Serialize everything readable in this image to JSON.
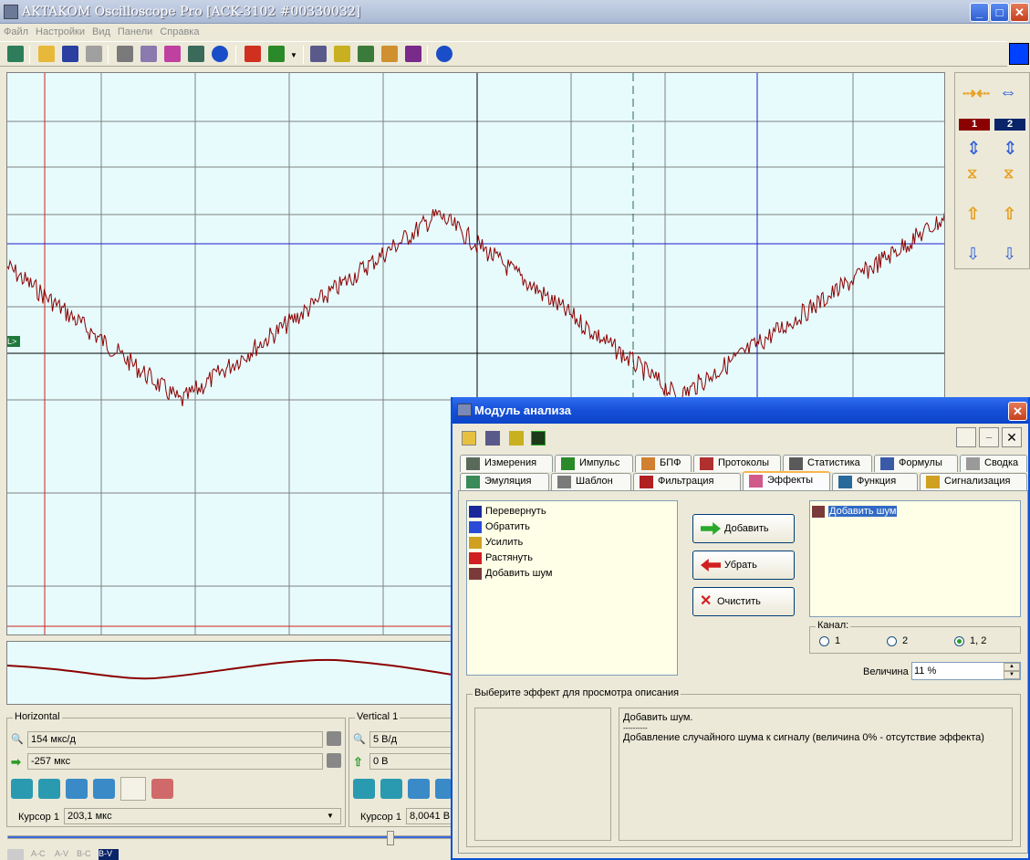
{
  "window": {
    "title": "AKTAKOM Oscilloscope Pro [ACK-3102 #00330032]"
  },
  "menu": [
    "Файл",
    "Настройки",
    "Вид",
    "Панели",
    "Справка"
  ],
  "channels": {
    "ch1": "1",
    "ch2": "2",
    "ch1_color": "#8b0000",
    "ch2_color": "#0a246a"
  },
  "horizontal": {
    "label": "Horizontal",
    "timebase": "154 мкс/д",
    "offset": "-257 мкс",
    "cursor_label": "Курсор 1",
    "cursor_value": "203,1 мкс"
  },
  "vertical": {
    "label": "Vertical 1",
    "scale": "5 В/д",
    "offset": "0 В",
    "cursor_label": "Курсор 1",
    "cursor_value": "8,0041 В"
  },
  "trigger_marker": "L>",
  "dialog": {
    "title": "Модуль анализа",
    "tabs_row1": [
      "Измерения",
      "Импульс",
      "БПФ",
      "Протоколы",
      "Статистика",
      "Формулы",
      "Сводка"
    ],
    "tabs_row2": [
      "Эмуляция",
      "Шаблон",
      "Фильтрация",
      "Эффекты",
      "Функция",
      "Сигнализация"
    ],
    "active_tab": "Эффекты",
    "effects": [
      "Перевернуть",
      "Обратить",
      "Усилить",
      "Растянуть",
      "Добавить шум"
    ],
    "buttons": {
      "add": "Добавить",
      "remove": "Убрать",
      "clear": "Очистить"
    },
    "selected_effects": [
      "Добавить шум"
    ],
    "channel_group": "Канал:",
    "channel_options": [
      "1",
      "2",
      "1, 2"
    ],
    "channel_selected": "1, 2",
    "magnitude_label": "Величина",
    "magnitude_value": "11 %",
    "desc_group": "Выберите эффект для просмотра описания",
    "desc_title": "Добавить шум.",
    "desc_separator": "----------",
    "desc_text": "Добавление случайного шума к сигналу (величина 0% - отсутствие эффекта)"
  },
  "status_tabs": [
    "A-C",
    "A-V",
    "B-C",
    "B-V"
  ],
  "colors": {
    "trace": "#8b0000",
    "grid": "#808080",
    "screen_bg": "#e7fbfd",
    "cursor_blue": "#1c1cc8",
    "cursor_green": "#2a6a4a",
    "cursor_red": "#cc2020"
  }
}
